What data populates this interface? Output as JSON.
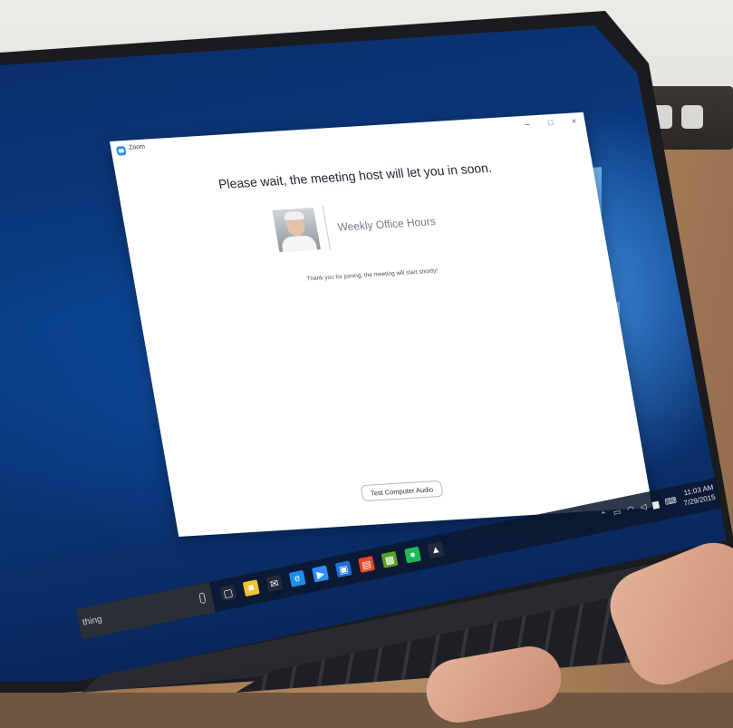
{
  "window": {
    "app_title": "Zoom",
    "controls": {
      "minimize": "–",
      "maximize": "□",
      "close": "×"
    }
  },
  "waiting_room": {
    "headline": "Please wait, the meeting host will let you in soon.",
    "meeting_title": "Weekly Office Hours",
    "message": "Thank you for joining, the meeting will start shortly!",
    "test_audio_label": "Test Computer Audio"
  },
  "taskbar": {
    "search_text": "thing",
    "apps": [
      {
        "name": "task-view-icon",
        "glyph": "▢",
        "color": "#1f2a3c"
      },
      {
        "name": "file-explorer-icon",
        "glyph": "■",
        "color": "#f2c230"
      },
      {
        "name": "mail-icon",
        "glyph": "✉",
        "color": "#1f2a3c"
      },
      {
        "name": "edge-icon",
        "glyph": "e",
        "color": "#1f8bef"
      },
      {
        "name": "zoom-app-icon",
        "glyph": "▶",
        "color": "#2d8cff"
      },
      {
        "name": "photos-icon",
        "glyph": "▣",
        "color": "#1e6fd6"
      },
      {
        "name": "office-icon",
        "glyph": "▤",
        "color": "#e4472b"
      },
      {
        "name": "minecraft-icon",
        "glyph": "▩",
        "color": "#5aa02c"
      },
      {
        "name": "spotify-icon",
        "glyph": "●",
        "color": "#1db954"
      },
      {
        "name": "store-icon",
        "glyph": "▲",
        "color": "#1f2a3c"
      }
    ],
    "tray": {
      "time": "11:03 AM",
      "date": "7/29/2015"
    }
  },
  "colors": {
    "zoom_blue": "#2d8cff",
    "desktop_blue": "#0a3f86"
  }
}
